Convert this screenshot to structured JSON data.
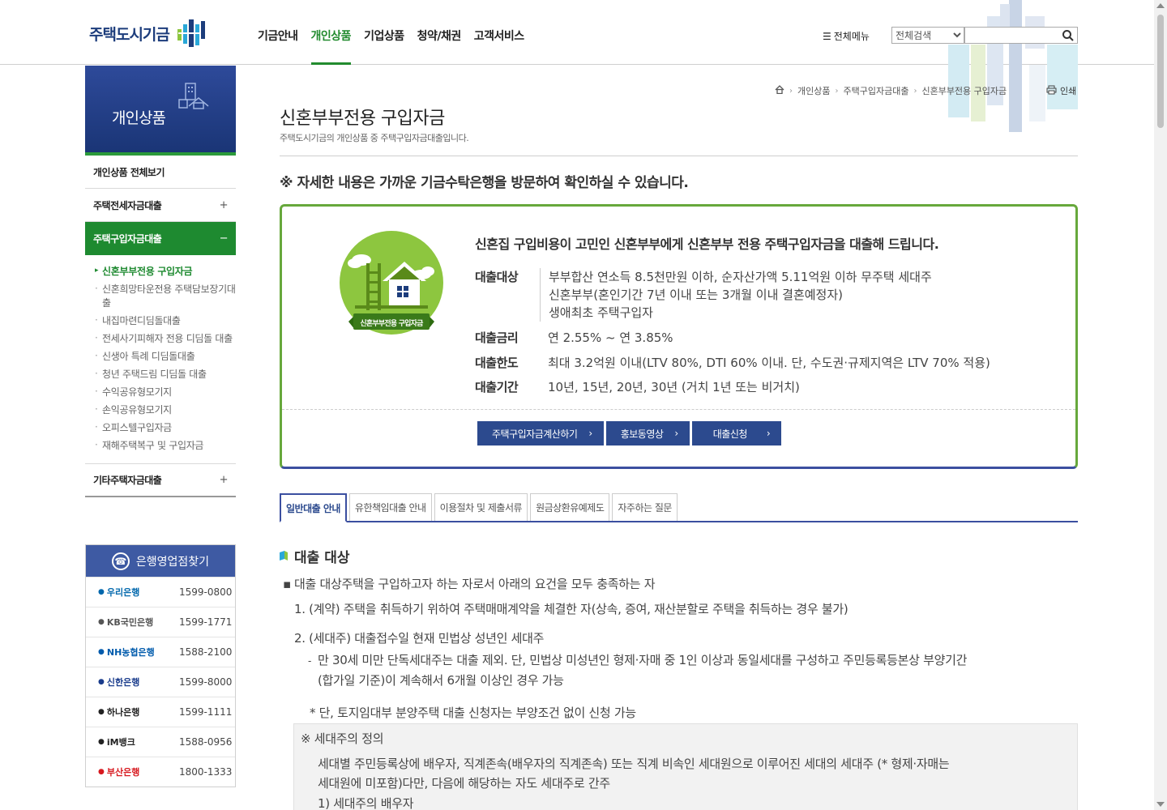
{
  "header": {
    "logo_text": "주택도시기금",
    "nav": [
      "기금안내",
      "개인상품",
      "기업상품",
      "청약/채권",
      "고객서비스"
    ],
    "nav_active_index": 1,
    "all_menu": "전체메뉴",
    "search_select": "전체검색",
    "search_value": ""
  },
  "sidebar": {
    "title": "개인상품",
    "items": [
      {
        "label": "개인상품 전체보기"
      },
      {
        "label": "주택전세자금대출",
        "toggle": "+"
      },
      {
        "label": "주택구입자금대출",
        "toggle": "−"
      },
      {
        "label": "기타주택자금대출",
        "toggle": "+"
      }
    ],
    "sub_items": [
      "신혼부부전용 구입자금",
      "신혼희망타운전용 주택담보장기대출",
      "내집마련디딤돌대출",
      "전세사기피해자 전용 디딤돌 대출",
      "신생아 특례 디딤돌대출",
      "청년 주택드림 디딤돌 대출",
      "수익공유형모기지",
      "손익공유형모기지",
      "오피스텔구입자금",
      "재해주택복구 및 구입자금"
    ]
  },
  "bank_box": {
    "title": "은행영업점찾기",
    "banks": [
      {
        "name": "우리은행",
        "phone": "1599-0800",
        "color": "#0067ac"
      },
      {
        "name": "KB국민은행",
        "phone": "1599-1771",
        "color": "#555555"
      },
      {
        "name": "NH농협은행",
        "phone": "1588-2100",
        "color": "#005bac"
      },
      {
        "name": "신한은행",
        "phone": "1599-8000",
        "color": "#1a3c8c"
      },
      {
        "name": "하나은행",
        "phone": "1599-1111",
        "color": "#222222"
      },
      {
        "name": "iM뱅크",
        "phone": "1588-0956",
        "color": "#222222"
      },
      {
        "name": "부산은행",
        "phone": "1800-1333",
        "color": "#d7191f"
      }
    ]
  },
  "breadcrumb": [
    "개인상품",
    "주택구입자금대출",
    "신혼부부전용 구입자금"
  ],
  "print_label": "인쇄",
  "page": {
    "title": "신혼부부전용 구입자금",
    "desc": "주택도시기금의 개인상품 중 주택구입자금대출입니다.",
    "notice": "※ 자세한 내용은 가까운 기금수탁은행을 방문하여 확인하실 수 있습니다."
  },
  "product": {
    "emblem_label": "신혼부부전용 구입자금",
    "headline": "신혼집 구입비용이 고민인 신혼부부에게 신혼부부 전용 주택구입자금을 대출해 드립니다.",
    "rows": [
      {
        "label": "대출대상",
        "lines": [
          "부부합산 연소득 8.5천만원 이하, 순자산가액 5.11억원 이하 무주택 세대주",
          "신혼부부(혼인기간 7년 이내 또는 3개월 이내 결혼예정자)",
          "생애최초 주택구입자"
        ]
      },
      {
        "label": "대출금리",
        "lines": [
          "연 2.55% ~ 연 3.85%"
        ]
      },
      {
        "label": "대출한도",
        "lines": [
          "최대 3.2억원 이내(LTV 80%, DTI 60% 이내. 단, 수도권·규제지역은 LTV 70% 적용)"
        ]
      },
      {
        "label": "대출기간",
        "lines": [
          "10년, 15년, 20년, 30년 (거치 1년 또는 비거치)"
        ]
      }
    ],
    "buttons": [
      "주택구입자금계산하기",
      "홍보동영상",
      "대출신청"
    ]
  },
  "tabs": [
    "일반대출 안내",
    "유한책임대출 안내",
    "이용절차 및 제출서류",
    "원금상환유예제도",
    "자주하는 질문"
  ],
  "detail": {
    "section_title": "대출 대상",
    "intro": "대출 대상주택을 구입하고자 하는 자로서 아래의 요건을 모두 충족하는 자",
    "item1": "1. (계약) 주택을 취득하기 위하여 주택매매계약을 체결한 자(상속, 증여, 재산분할로 주택을 취득하는 경우 불가)",
    "item2": "2. (세대주) 대출접수일 현재 민법상 성년인 세대주",
    "item2_sub1": "만 30세 미만 단독세대주는 대출 제외. 단, 민법상 미성년인 형제·자매 중 1인 이상과 동일세대를 구성하고 주민등록등본상 부양기간",
    "item2_sub2": "(합가일 기준)이 계속해서 6개월 이상인 경우 가능",
    "item2_note": "* 단, 토지임대부 분양주택 대출 신청자는 부양조건 없이 신청 가능",
    "box_title": "※ 세대주의 정의",
    "box_line1": "세대별 주민등록상에 배우자, 직계존속(배우자의 직계존속) 또는 직계 비속인 세대원으로 이루어진 세대의 세대주 (* 형제·자매는",
    "box_line2": "세대원에 미포함)다만, 다음에 해당하는 자도 세대주로 간주",
    "box_line3": "1) 세대주의 배우자"
  },
  "colors": {
    "brand_green": "#1e8a30",
    "brand_navy": "#2c4a8e",
    "product_green": "#8dc63f"
  }
}
